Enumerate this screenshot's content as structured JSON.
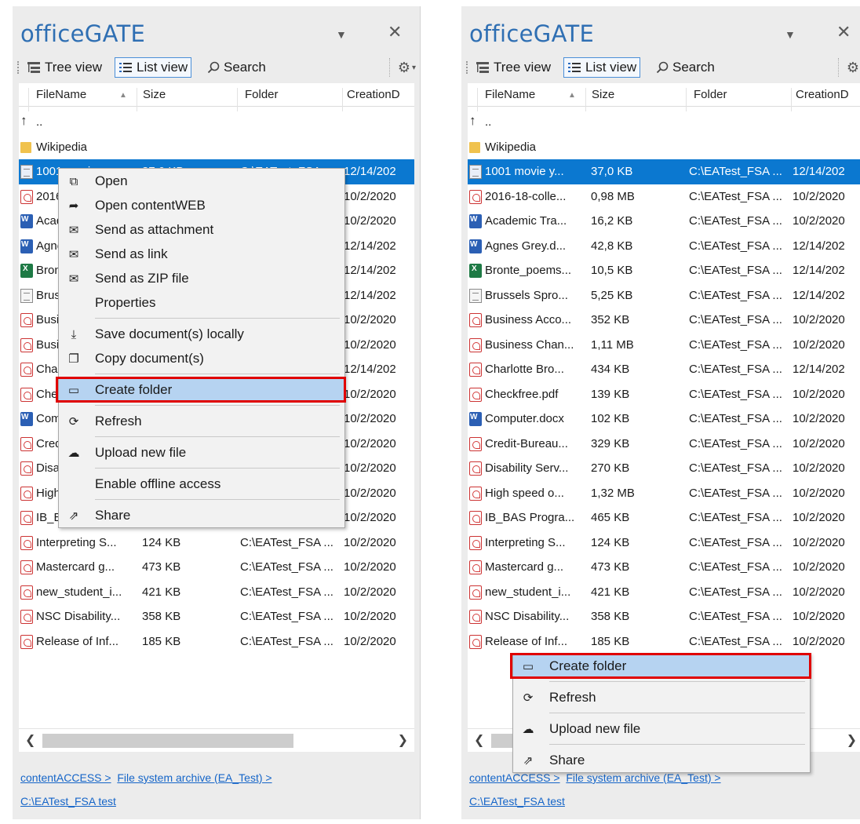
{
  "app_title": "officeGATE",
  "toolbar": {
    "tree_view": "Tree view",
    "list_view": "List view",
    "search": "Search"
  },
  "columns": {
    "filename": "FileName",
    "size": "Size",
    "folder": "Folder",
    "creation": "CreationD"
  },
  "parent_row": "..",
  "left_rows": [
    {
      "name": "..",
      "size": "",
      "folder": "",
      "date": "",
      "icon": "up-arrow"
    },
    {
      "name": "Wikipedia",
      "size": "",
      "folder": "",
      "date": "",
      "icon": "folder"
    },
    {
      "name": "1001 movie y...",
      "size": "37,0 KB",
      "folder": "C:\\EATest_FSA ...",
      "date": "12/14/202",
      "icon": "text"
    },
    {
      "name": "2016-18-colle...",
      "size": "0,98 MB",
      "folder": "C:\\EATest_FSA ...",
      "date": "10/2/2020",
      "icon": "pdf"
    },
    {
      "name": "Academic Tra...",
      "size": "16,2 KB",
      "folder": "C:\\EATest_FSA ...",
      "date": "10/2/2020",
      "icon": "word"
    },
    {
      "name": "Agnes Grey.d...",
      "size": "42,8 KB",
      "folder": "C:\\EATest_FSA ...",
      "date": "12/14/202",
      "icon": "word"
    },
    {
      "name": "Bronte_poems...",
      "size": "10,5 KB",
      "folder": "C:\\EATest_FSA ...",
      "date": "12/14/202",
      "icon": "excel"
    },
    {
      "name": "Brussels Spro...",
      "size": "5,25 KB",
      "folder": "C:\\EATest_FSA ...",
      "date": "12/14/202",
      "icon": "text"
    },
    {
      "name": "Business Acco...",
      "size": "352 KB",
      "folder": "C:\\EATest_FSA ...",
      "date": "10/2/2020",
      "icon": "pdf"
    },
    {
      "name": "Business Chan...",
      "size": "1,11 MB",
      "folder": "C:\\EATest_FSA ...",
      "date": "10/2/2020",
      "icon": "pdf"
    },
    {
      "name": "Charlotte Bro...",
      "size": "434 KB",
      "folder": "C:\\EATest_FSA ...",
      "date": "12/14/202",
      "icon": "pdf"
    },
    {
      "name": "Checkfree.pdf",
      "size": "139 KB",
      "folder": "C:\\EATest_FSA ...",
      "date": "10/2/2020",
      "icon": "pdf"
    },
    {
      "name": "Computer.docx",
      "size": "102 KB",
      "folder": "C:\\EATest_FSA ...",
      "date": "10/2/2020",
      "icon": "word"
    },
    {
      "name": "Credit-Bureau...",
      "size": "329 KB",
      "folder": "C:\\EATest_FSA ...",
      "date": "10/2/2020",
      "icon": "pdf"
    },
    {
      "name": "Disability Serv...",
      "size": "270 KB",
      "folder": "C:\\EATest_FSA ...",
      "date": "10/2/2020",
      "icon": "pdf"
    },
    {
      "name": "High speed o...",
      "size": "1,32 MB",
      "folder": "C:\\EATest_FSA ...",
      "date": "10/2/2020",
      "icon": "pdf"
    },
    {
      "name": "IB_BAS Progra...",
      "size": "465 KB",
      "folder": "C:\\EATest_FSA ...",
      "date": "10/2/2020",
      "icon": "pdf"
    },
    {
      "name": "Interpreting S...",
      "size": "124 KB",
      "folder": "C:\\EATest_FSA ...",
      "date": "10/2/2020",
      "icon": "pdf"
    },
    {
      "name": "Mastercard g...",
      "size": "473 KB",
      "folder": "C:\\EATest_FSA ...",
      "date": "10/2/2020",
      "icon": "pdf"
    },
    {
      "name": "new_student_i...",
      "size": "421 KB",
      "folder": "C:\\EATest_FSA ...",
      "date": "10/2/2020",
      "icon": "pdf"
    },
    {
      "name": "NSC Disability...",
      "size": "358 KB",
      "folder": "C:\\EATest_FSA ...",
      "date": "10/2/2020",
      "icon": "pdf"
    },
    {
      "name": "Release of Inf...",
      "size": "185 KB",
      "folder": "C:\\EATest_FSA ...",
      "date": "10/2/2020",
      "icon": "pdf"
    }
  ],
  "left_menu": [
    {
      "label": "Open",
      "icon": "open-external-icon"
    },
    {
      "label": "Open contentWEB",
      "icon": "forward-arrow-icon"
    },
    {
      "label": "Send as attachment",
      "icon": "mail-attachment-icon"
    },
    {
      "label": "Send as link",
      "icon": "mail-link-icon"
    },
    {
      "label": "Send as ZIP file",
      "icon": "mail-zip-icon"
    },
    {
      "label": "Properties",
      "icon": ""
    },
    {
      "sep": true
    },
    {
      "label": "Save document(s) locally",
      "icon": "download-icon"
    },
    {
      "label": "Copy document(s)",
      "icon": "copy-icon"
    },
    {
      "sep": true
    },
    {
      "label": "Create folder",
      "icon": "new-folder-icon",
      "highlight": true
    },
    {
      "sep": true
    },
    {
      "label": "Refresh",
      "icon": "refresh-icon"
    },
    {
      "sep": true
    },
    {
      "label": "Upload new file",
      "icon": "cloud-upload-icon"
    },
    {
      "sep": true
    },
    {
      "label": "Enable offline access",
      "icon": ""
    },
    {
      "sep": true
    },
    {
      "label": "Share",
      "icon": "share-icon"
    }
  ],
  "right_menu": [
    {
      "label": "Create folder",
      "icon": "new-folder-icon",
      "highlight": true
    },
    {
      "sep": true
    },
    {
      "label": "Refresh",
      "icon": "refresh-icon"
    },
    {
      "sep": true
    },
    {
      "label": "Upload new file",
      "icon": "cloud-upload-icon"
    },
    {
      "sep": true
    },
    {
      "label": "Share",
      "icon": "share-icon"
    }
  ],
  "footer": {
    "crumb1": "contentACCESS >",
    "crumb2": "File system archive (EA_Test) >",
    "crumb3": "C:\\EATest_FSA test"
  },
  "colors": {
    "title": "#2f6fb3",
    "selected_row": "#0b78d0",
    "menu_highlight": "#b6d3f1",
    "highlight_border": "#e00000"
  }
}
